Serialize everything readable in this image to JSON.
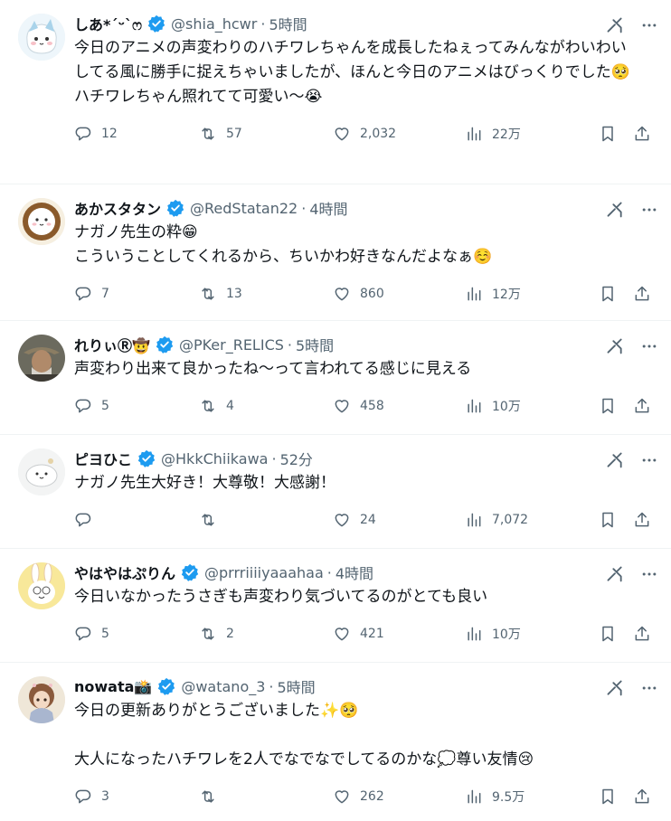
{
  "tweets": [
    {
      "name": "しあ*´ᵕ`ෆ",
      "handle": "@shia_hcwr",
      "time": "5時間",
      "text": "今日のアニメの声変わりのハチワレちゃんを成長したねぇってみんながわいわいしてる風に勝手に捉えちゃいましたが、ほんと今日のアニメはびっくりでした🥺\nハチワレちゃん照れてて可愛い～😭",
      "replies": "12",
      "retweets": "57",
      "likes": "2,032",
      "views": "22万"
    },
    {
      "name": "あかスタタン",
      "handle": "@RedStatan22",
      "time": "4時間",
      "text": "ナガノ先生の粋😁\nこういうことしてくれるから、ちいかわ好きなんだよなぁ☺️",
      "replies": "7",
      "retweets": "13",
      "likes": "860",
      "views": "12万"
    },
    {
      "name": "れりぃⓇ🤠",
      "handle": "@PKer_RELICS",
      "time": "5時間",
      "text": "声変わり出来て良かったね～って言われてる感じに見える",
      "replies": "5",
      "retweets": "4",
      "likes": "458",
      "views": "10万"
    },
    {
      "name": "ピヨひこ",
      "handle": "@HkkChiikawa",
      "time": "52分",
      "text": "ナガノ先生大好き！大尊敬！大感謝！",
      "replies": "",
      "retweets": "",
      "likes": "24",
      "views": "7,072"
    },
    {
      "name": "やはやはぷりん",
      "handle": "@prrriiiiyaaahaa",
      "time": "4時間",
      "text": "今日いなかったうさぎも声変わり気づいてるのがとても良い",
      "replies": "5",
      "retweets": "2",
      "likes": "421",
      "views": "10万"
    },
    {
      "name": "nowata📸",
      "handle": "@watano_3",
      "time": "5時間",
      "text": "今日の更新ありがとうございました✨🥺\n\n大人になったハチワレを2人でなでなでしてるのかな💭尊い友情😢",
      "replies": "3",
      "retweets": "",
      "likes": "262",
      "views": "9.5万"
    }
  ],
  "icons": {
    "verified": "verified-badge-icon",
    "grok": "grok-icon",
    "more": "more-icon",
    "reply": "reply-icon",
    "retweet": "retweet-icon",
    "like": "heart-icon",
    "views": "views-icon",
    "bookmark": "bookmark-icon",
    "share": "share-icon"
  },
  "colors": {
    "verified": "#1d9bf0",
    "text": "#0f1419",
    "muted": "#536471",
    "border": "#eff3f4"
  }
}
